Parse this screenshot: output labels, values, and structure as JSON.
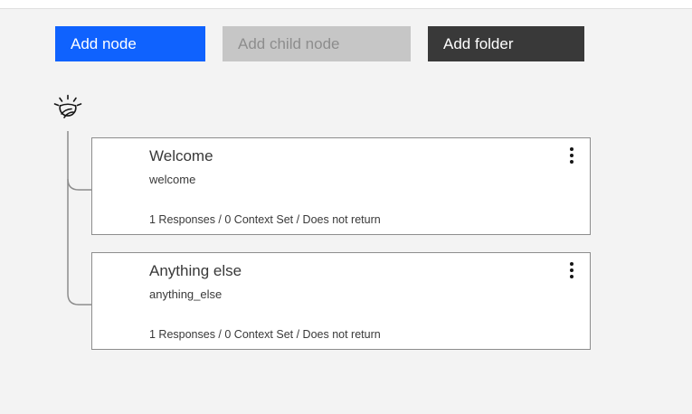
{
  "toolbar": {
    "add_node_label": "Add node",
    "add_child_node_label": "Add child node",
    "add_folder_label": "Add folder"
  },
  "colors": {
    "primary": "#0f62fe",
    "disabled": "#c6c6c6",
    "dark": "#393939",
    "background": "#f3f3f3"
  },
  "tree": {
    "root_icon": "ibm-watson-icon",
    "nodes": [
      {
        "title": "Welcome",
        "condition": "welcome",
        "summary": "1 Responses / 0 Context Set / Does not return"
      },
      {
        "title": "Anything else",
        "condition": "anything_else",
        "summary": "1 Responses / 0 Context Set / Does not return"
      }
    ]
  }
}
